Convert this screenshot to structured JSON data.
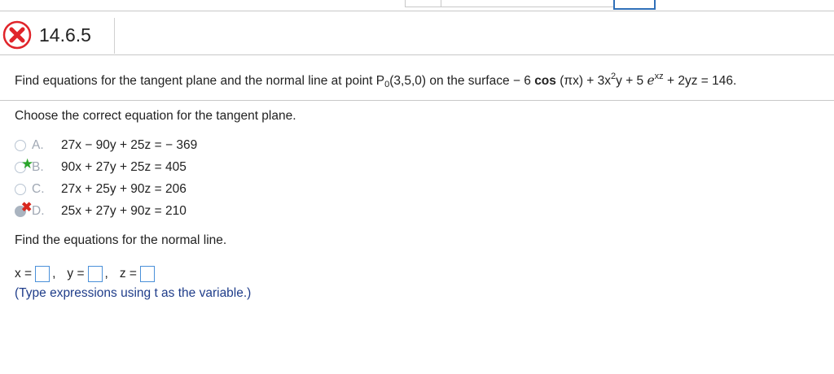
{
  "question": {
    "number": "14.6.5",
    "status_icon": "red-x-incorrect-icon"
  },
  "problem": {
    "prefix": "Find equations for the tangent plane and the normal line at point P",
    "point_sub": "0",
    "point_coords": "(3,5,0) on the surface  − 6 ",
    "cos": "cos",
    "after_cos": " (πx) + 3x",
    "sup1": "2",
    "mid": "y + 5 ",
    "e": "e",
    "sup2": "xz",
    "suffix": " + 2yz = 146."
  },
  "part1": {
    "prompt": "Choose the correct equation for the tangent plane.",
    "choices": [
      {
        "letter": "A.",
        "text": "27x − 90y + 25z =  − 369",
        "mark": "",
        "selected": false
      },
      {
        "letter": "B.",
        "text": "90x + 27y + 25z = 405",
        "mark": "★",
        "selected": false
      },
      {
        "letter": "C.",
        "text": "27x + 25y + 90z = 206",
        "mark": "",
        "selected": false
      },
      {
        "letter": "D.",
        "text": "25x + 27y + 90z = 210",
        "mark": "✖",
        "selected": true
      }
    ]
  },
  "part2": {
    "prompt": "Find the equations for the normal line.",
    "x_label": "x =",
    "y_label": "y =",
    "z_label": "z =",
    "comma": ",",
    "hint": "(Type expressions using t as the variable.)"
  },
  "colors": {
    "correct_star": "#2aa52a",
    "incorrect_mark": "#d8281e",
    "hint_text": "#1f3d8a",
    "input_border": "#4a90d9"
  }
}
